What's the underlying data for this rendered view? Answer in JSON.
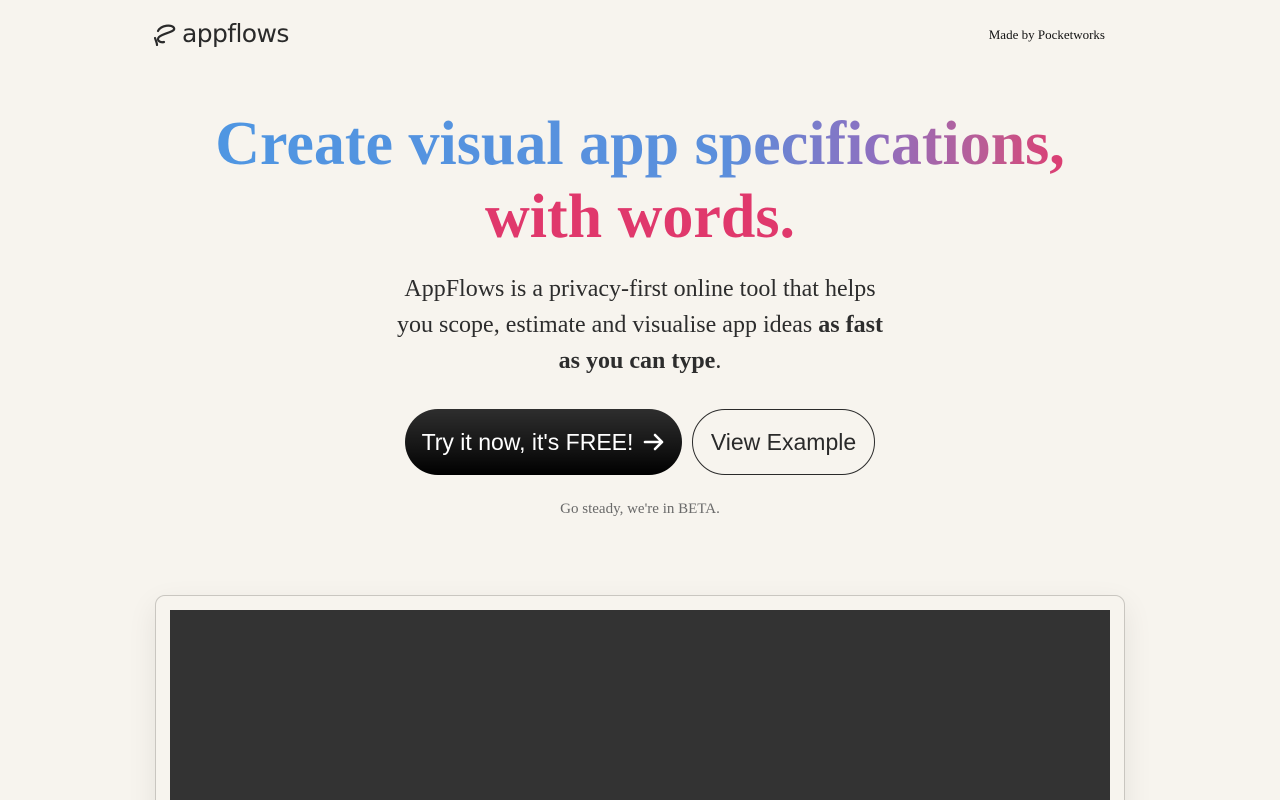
{
  "header": {
    "logo_text": "appflows",
    "made_by": "Made by Pocketworks"
  },
  "hero": {
    "title_line_1": "Create visual app specifications,",
    "title_line_2": "with words.",
    "subtitle_lead": "AppFlows is a privacy-first online tool that helps you scope, estimate and visualise app ideas ",
    "subtitle_emphasis": "as fast as you can type",
    "subtitle_end": "."
  },
  "cta": {
    "primary_label": "Try it now, it's FREE!",
    "secondary_label": "View Example"
  },
  "beta_note": "Go steady, we're in BETA.",
  "colors": {
    "background": "#f7f4ee",
    "gradient_blue": "#4f96e2",
    "gradient_pink": "#e0386c",
    "primary_button": "#141414",
    "preview_screen": "#333333"
  },
  "icons": {
    "logo": "appflows-squiggle-icon",
    "cta_arrow": "arrow-right-icon"
  }
}
